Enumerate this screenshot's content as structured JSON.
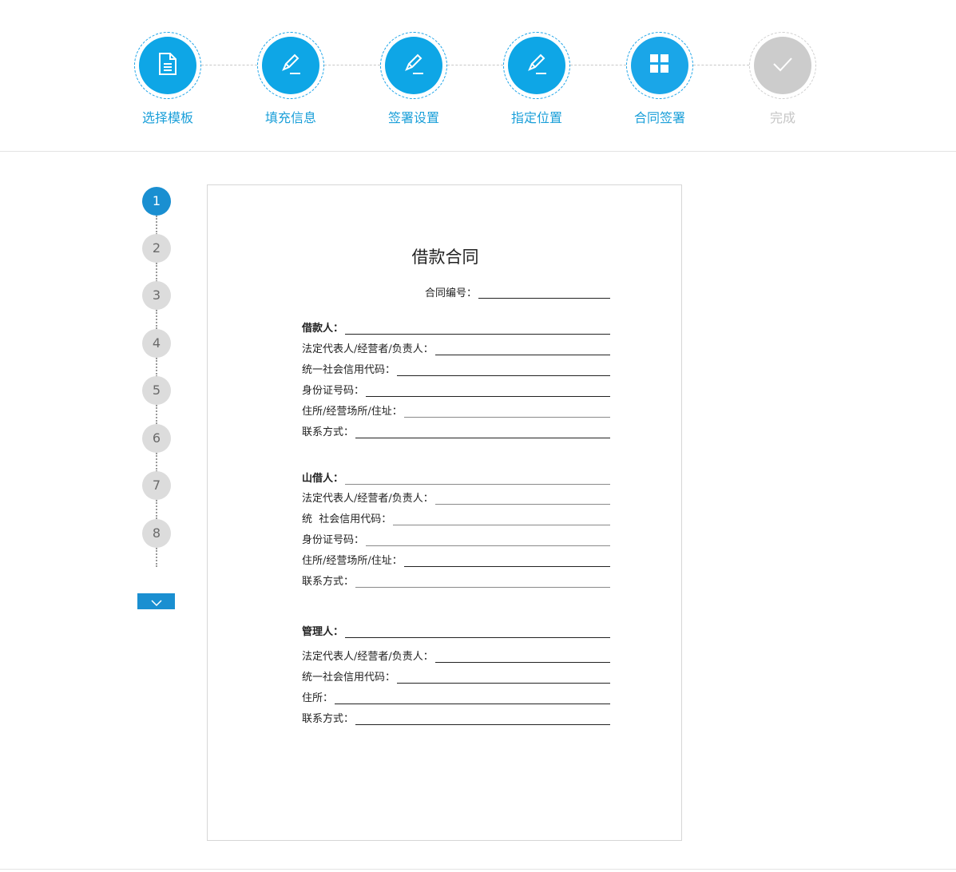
{
  "steps": [
    {
      "label": "选择模板",
      "icon": "document-icon",
      "state": "done"
    },
    {
      "label": "填充信息",
      "icon": "pencil-icon",
      "state": "done"
    },
    {
      "label": "签署设置",
      "icon": "pencil-icon",
      "state": "done"
    },
    {
      "label": "指定位置",
      "icon": "pencil-icon",
      "state": "done"
    },
    {
      "label": "合同签署",
      "icon": "grid-icon",
      "state": "current"
    },
    {
      "label": "完成",
      "icon": "check-icon",
      "state": "pending"
    }
  ],
  "colors": {
    "accent": "#0ea6e6",
    "nav_active": "#1a8fd1",
    "inactive": "#cccccc"
  },
  "page_nav": {
    "pages": [
      "1",
      "2",
      "3",
      "4",
      "5",
      "6",
      "7",
      "8"
    ],
    "active_page": "1",
    "next_icon": "chevron-down-icon"
  },
  "document": {
    "title": "借款合同",
    "contract_no_label": "合同编号：",
    "borrower": {
      "heading": "借款人：",
      "fields": [
        "法定代表人/经营者/负责人：",
        "统一社会信用代码：",
        "身份证号码：",
        "住所/经营场所/住址：",
        "联系方式："
      ]
    },
    "lender": {
      "heading": "山借人：",
      "fields": [
        "法定代表人/经营者/负责人：",
        "统  社会信用代码：",
        "身份证号码：",
        "住所/经营场所/住址：",
        "联系方式："
      ]
    },
    "manager": {
      "heading": "管理人：",
      "fields": [
        "法定代表人/经营者/负责人：",
        "统一社会信用代码：",
        "住所：",
        "联系方式："
      ]
    }
  }
}
